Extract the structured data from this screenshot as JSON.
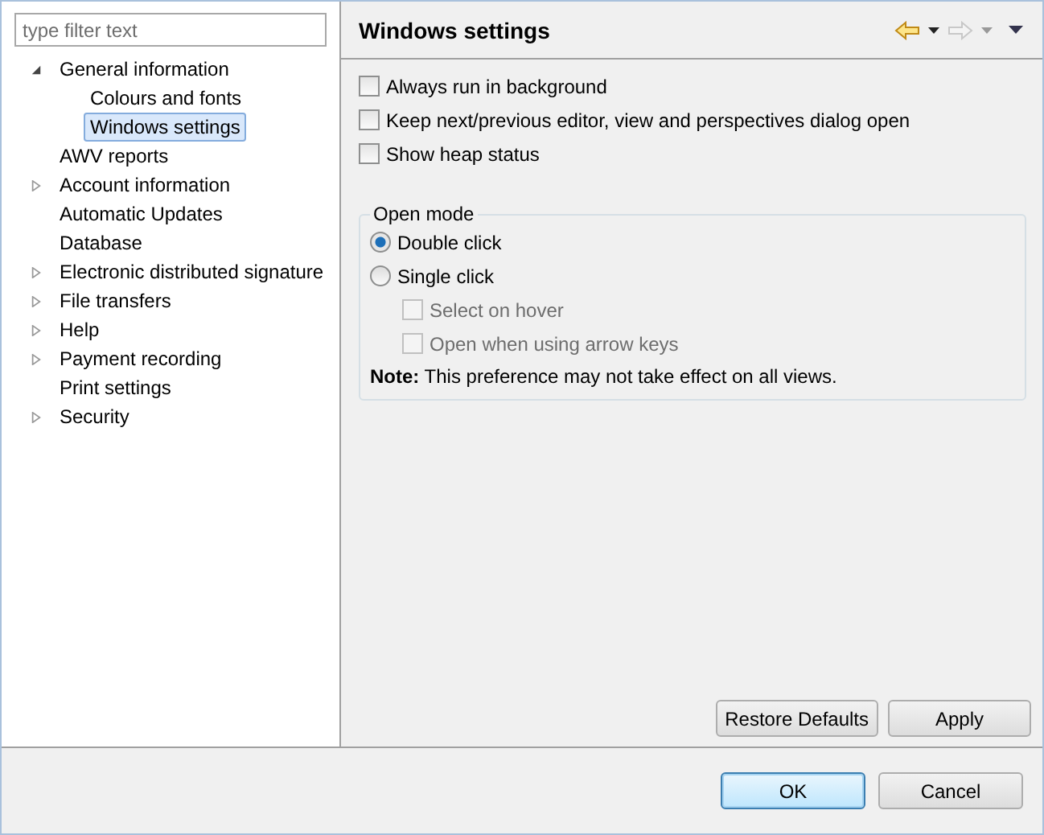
{
  "filter": {
    "placeholder": "type filter text"
  },
  "tree": [
    {
      "label": "General information",
      "kind": "folder",
      "expanded": true,
      "selected": false,
      "children": [
        {
          "label": "Colours and fonts",
          "kind": "leaf",
          "selected": false
        },
        {
          "label": "Windows settings",
          "kind": "leaf",
          "selected": true
        }
      ]
    },
    {
      "label": "AWV reports",
      "kind": "leaf",
      "selected": false
    },
    {
      "label": "Account information",
      "kind": "folder",
      "expanded": false,
      "selected": false
    },
    {
      "label": "Automatic Updates",
      "kind": "leaf",
      "selected": false
    },
    {
      "label": "Database",
      "kind": "leaf",
      "selected": false
    },
    {
      "label": "Electronic distributed signature",
      "kind": "folder",
      "expanded": false,
      "selected": false
    },
    {
      "label": "File transfers",
      "kind": "folder",
      "expanded": false,
      "selected": false
    },
    {
      "label": "Help",
      "kind": "folder",
      "expanded": false,
      "selected": false
    },
    {
      "label": "Payment recording",
      "kind": "folder",
      "expanded": false,
      "selected": false
    },
    {
      "label": "Print settings",
      "kind": "leaf",
      "selected": false
    },
    {
      "label": "Security",
      "kind": "folder",
      "expanded": false,
      "selected": false
    }
  ],
  "page": {
    "title": "Windows settings",
    "back_enabled": true,
    "forward_enabled": false
  },
  "options": [
    {
      "label": "Always run in background",
      "checked": false
    },
    {
      "label": "Keep next/previous editor, view and perspectives dialog open",
      "checked": false
    },
    {
      "label": "Show heap status",
      "checked": false
    }
  ],
  "open_mode": {
    "title": "Open mode",
    "radios": [
      {
        "label": "Double click",
        "selected": true
      },
      {
        "label": "Single click",
        "selected": false
      }
    ],
    "sub_options": [
      {
        "label": "Select on hover",
        "checked": false,
        "disabled": true
      },
      {
        "label": "Open when using arrow keys",
        "checked": false,
        "disabled": true
      }
    ],
    "note": "**Note:** This preference may not take effect on all views."
  },
  "page_buttons": [
    "Restore Defaults",
    "Apply"
  ],
  "dialog_buttons": [
    {
      "label": "OK",
      "default": true
    },
    {
      "label": "Cancel",
      "default": false
    }
  ]
}
